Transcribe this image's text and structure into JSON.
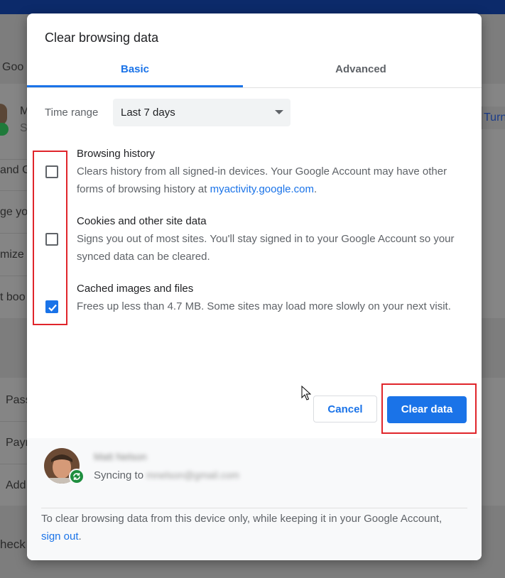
{
  "background": {
    "fragments": [
      "Goo",
      "M",
      "S",
      "and G",
      "ge yo",
      "mize",
      "t boo",
      "Pass",
      "Payr",
      "Add",
      "heck"
    ],
    "turn_label": "Turn"
  },
  "dialog": {
    "title": "Clear browsing data",
    "tabs": [
      {
        "label": "Basic",
        "active": true
      },
      {
        "label": "Advanced",
        "active": false
      }
    ],
    "time_range": {
      "label": "Time range",
      "value": "Last 7 days"
    },
    "options": [
      {
        "title": "Browsing history",
        "desc": "Clears history from all signed-in devices. Your Google Account may have other forms of browsing history at",
        "link": "myactivity.google.com",
        "desc_end": ".",
        "checked": false
      },
      {
        "title": "Cookies and other site data",
        "desc": "Signs you out of most sites. You'll stay signed in to your Google Account so your synced data can be cleared.",
        "checked": false
      },
      {
        "title": "Cached images and files",
        "desc": "Frees up less than 4.7 MB. Some sites may load more slowly on your next visit.",
        "checked": true
      }
    ],
    "buttons": {
      "cancel": "Cancel",
      "clear": "Clear data"
    },
    "footer": {
      "user_name": "Matt Nelson",
      "syncing_label": "Syncing to",
      "email": "mnelson@gmail.com",
      "note_before": "To clear browsing data from this device only, while keeping it in your Google Account,",
      "note_link": "sign out",
      "note_after": "."
    }
  },
  "colors": {
    "accent": "#1a73e8",
    "highlight": "#e0252b",
    "sync_green": "#1e8e3e"
  }
}
